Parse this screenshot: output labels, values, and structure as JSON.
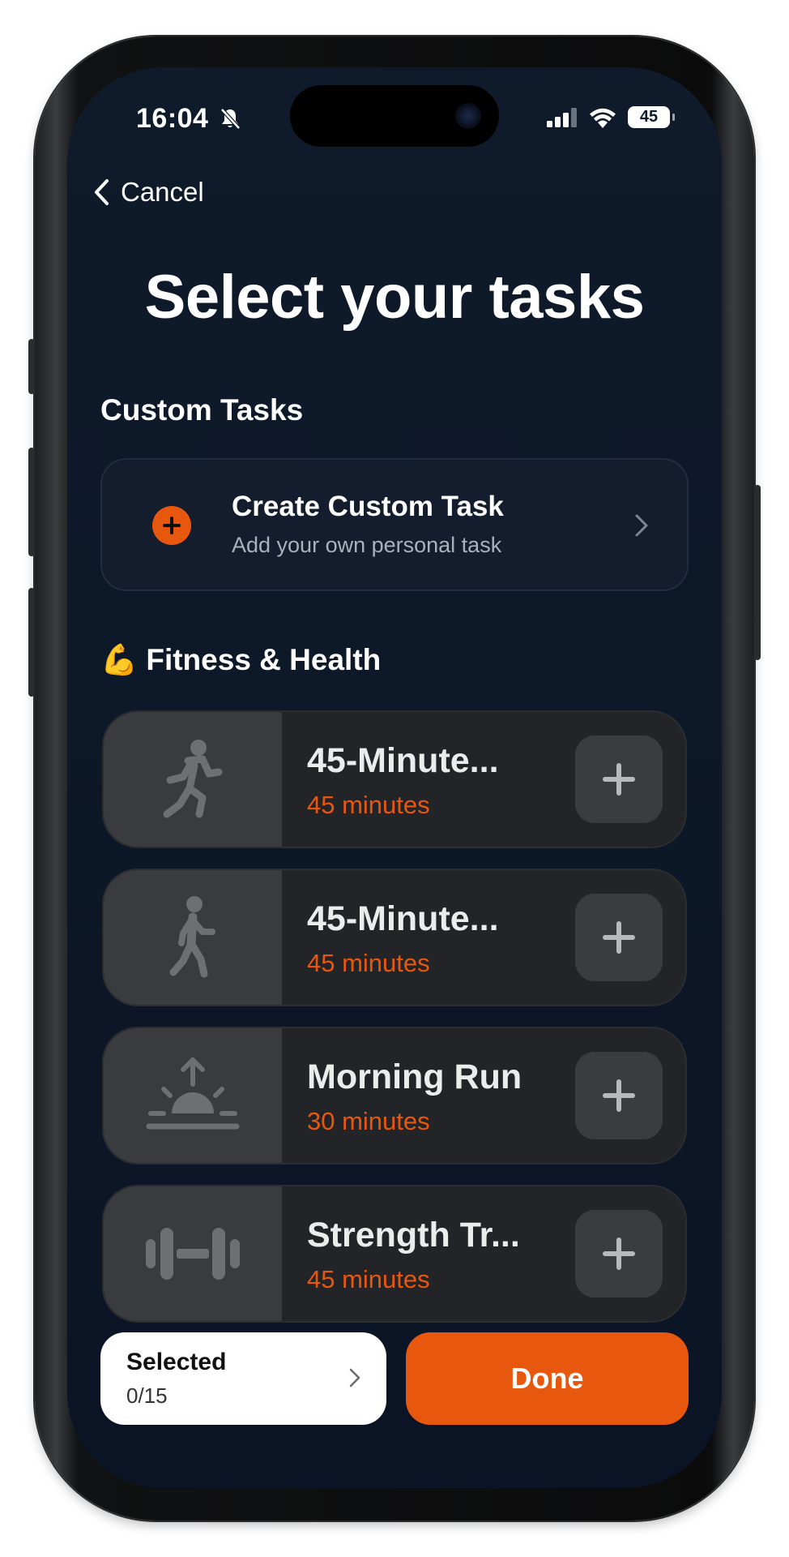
{
  "status_bar": {
    "time": "16:04",
    "battery": "45",
    "icons": [
      "bell-slash-icon",
      "cellular-signal-icon",
      "wifi-icon",
      "battery-icon"
    ]
  },
  "nav": {
    "back_label": "Cancel"
  },
  "page": {
    "title": "Select your tasks"
  },
  "custom_section": {
    "title": "Custom Tasks",
    "card_title": "Create Custom Task",
    "card_subtitle": "Add your own personal task"
  },
  "fitness_section": {
    "emoji": "💪",
    "title": "Fitness & Health",
    "tasks": [
      {
        "title": "45-Minute...",
        "duration": "45 minutes",
        "icon": "running-figure-icon"
      },
      {
        "title": "45-Minute...",
        "duration": "45 minutes",
        "icon": "walking-figure-icon"
      },
      {
        "title": "Morning Run",
        "duration": "30 minutes",
        "icon": "sunrise-icon"
      },
      {
        "title": "Strength Tr...",
        "duration": "45 minutes",
        "icon": "dumbbell-icon"
      }
    ]
  },
  "footer": {
    "selected_label": "Selected",
    "selected_count": "0/15",
    "done_label": "Done"
  },
  "colors": {
    "accent": "#e8570e",
    "background": "#0f1a2b",
    "card": "#232427",
    "icon_box": "#3a3b3e"
  }
}
